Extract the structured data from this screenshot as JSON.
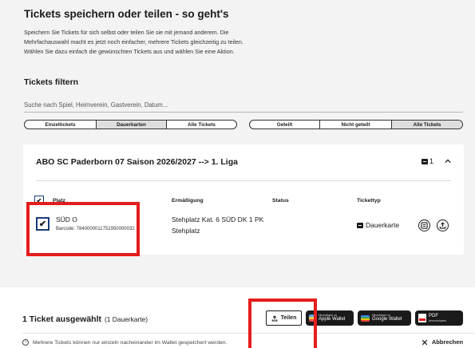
{
  "guide": {
    "title": "Tickets speichern oder teilen - so geht's",
    "lines": [
      "Speichern Sie Tickets für sich selbst oder teilen Sie sie mit jemand anderem. Die",
      "Mehrfachauswahl macht es jetzt noch einfacher, mehrere Tickets gleichzeitig zu teilen.",
      "Wählen Sie dazu einfach die gewünschten Tickets aus und wählen Sie eine Aktion."
    ]
  },
  "filter": {
    "title": "Tickets filtern",
    "search_placeholder": "Suche nach Spiel, Heimverein, Gastverein, Datum...",
    "segment_type": {
      "options": [
        "Einzeltickets",
        "Dauerkarten",
        "Alle Tickets"
      ],
      "selected": "Dauerkarten"
    },
    "segment_share": {
      "options": [
        "Geteilt",
        "Nicht geteilt",
        "Alle Tickets"
      ],
      "selected": "Alle Tickets"
    }
  },
  "card": {
    "title": "ABO SC Paderborn 07 Saison 2026/2027 --> 1. Liga",
    "count": "1",
    "expanded": true,
    "headers": {
      "place": "Platz",
      "discount": "Ermäßigung",
      "status": "Status",
      "type": "Tickettyp"
    },
    "ticket": {
      "checked": true,
      "name": "SÜD O",
      "barcode": "Barcode: 7840000011751950000032",
      "discount_line1": "Stehplatz Kat. 6 SÜD DK 1 PK",
      "discount_line2": "Stehplatz",
      "status": "",
      "type": "Dauerkarte"
    }
  },
  "bottom_bar": {
    "selected_bold": "1 Ticket ausgewählt",
    "selected_sub": "(1 Dauerkarte)",
    "share_label": "Teilen",
    "apple_wallet_small": "Hinzufügen zu",
    "apple_wallet_big": "Apple Wallet",
    "google_wallet_small": "Hinzufügen zu",
    "google_wallet_big": "Google Wallet",
    "pdf_big": "PDF",
    "pdf_small": "herunterladen",
    "note": "Mehrere Tickets können nur einzeln nacheinander im Wallet gespeichert werden.",
    "cancel_label": "Abbrechen"
  },
  "colors": {
    "highlight": "#e51c1c",
    "checkbox_border": "#1a3a7a",
    "page_bg": "#f3f3f3"
  }
}
